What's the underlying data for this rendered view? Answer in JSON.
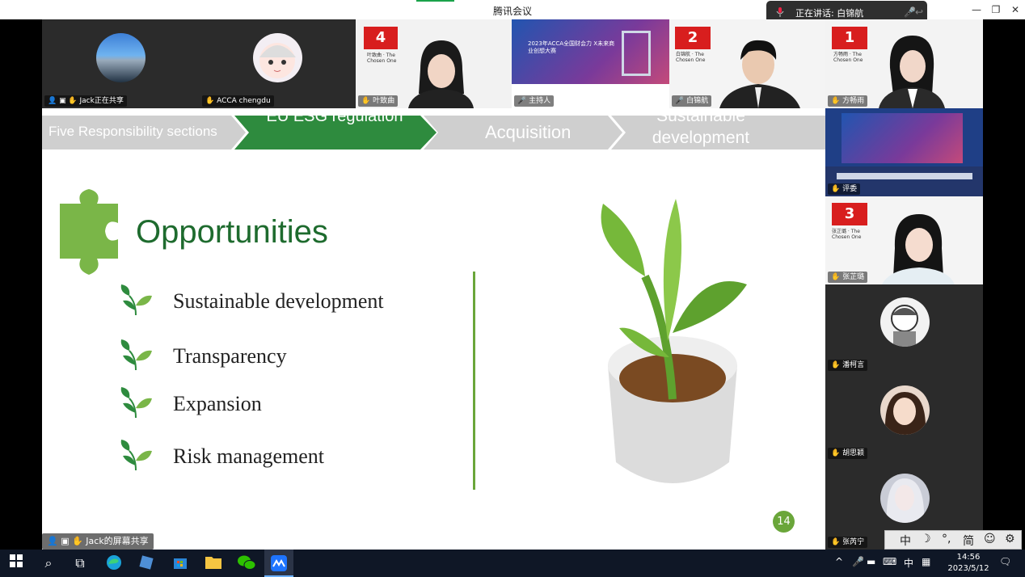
{
  "window": {
    "title": "腾讯会议",
    "speaking_label": "正在讲话:",
    "speaking_name": "白锦航"
  },
  "participants": [
    {
      "name": "Jack正在共享",
      "avatar": "building-photo"
    },
    {
      "name": "ACCA chengdu",
      "avatar": "anime-avatar"
    },
    {
      "name": "叶致曲",
      "rank": "4",
      "caption": "叶致曲 · The Chosen One"
    },
    {
      "name": "主持人",
      "caption": "2023年ACCA全国财会力 X未来商业创想大赛"
    },
    {
      "name": "白锦航",
      "rank": "2",
      "caption": "白锦航 · The Chosen One"
    },
    {
      "name": "方畅雨",
      "rank": "1",
      "caption": "方畅雨 · The Chosen One"
    },
    {
      "name": "评委"
    },
    {
      "name": "张芷璐",
      "rank": "3",
      "caption": "张芷璐 · The Chosen One"
    },
    {
      "name": "潘柯言"
    },
    {
      "name": "胡思颖"
    },
    {
      "name": "张芮宁"
    }
  ],
  "slide": {
    "steps": [
      "Five Responsibility sections",
      "EU ESG regulation",
      "Acquisition",
      "Sustainable development"
    ],
    "title": "Opportunities",
    "bullets": [
      "Sustainable development",
      "Transparency",
      "Expansion",
      "Risk management"
    ],
    "page_number": "14",
    "colors": {
      "green_dark": "#2e8b3e",
      "green_light": "#7ab648",
      "title_green": "#1e6b2e",
      "chevron_grey": "#cfcfcf"
    }
  },
  "share_label": "Jack的屏幕共享",
  "ime": {
    "items": [
      "中",
      "☽",
      "°,",
      "简",
      "☺",
      "⚙"
    ]
  },
  "taskbar": {
    "tray_ime": "中",
    "time": "14:56",
    "date": "2023/5/12"
  }
}
